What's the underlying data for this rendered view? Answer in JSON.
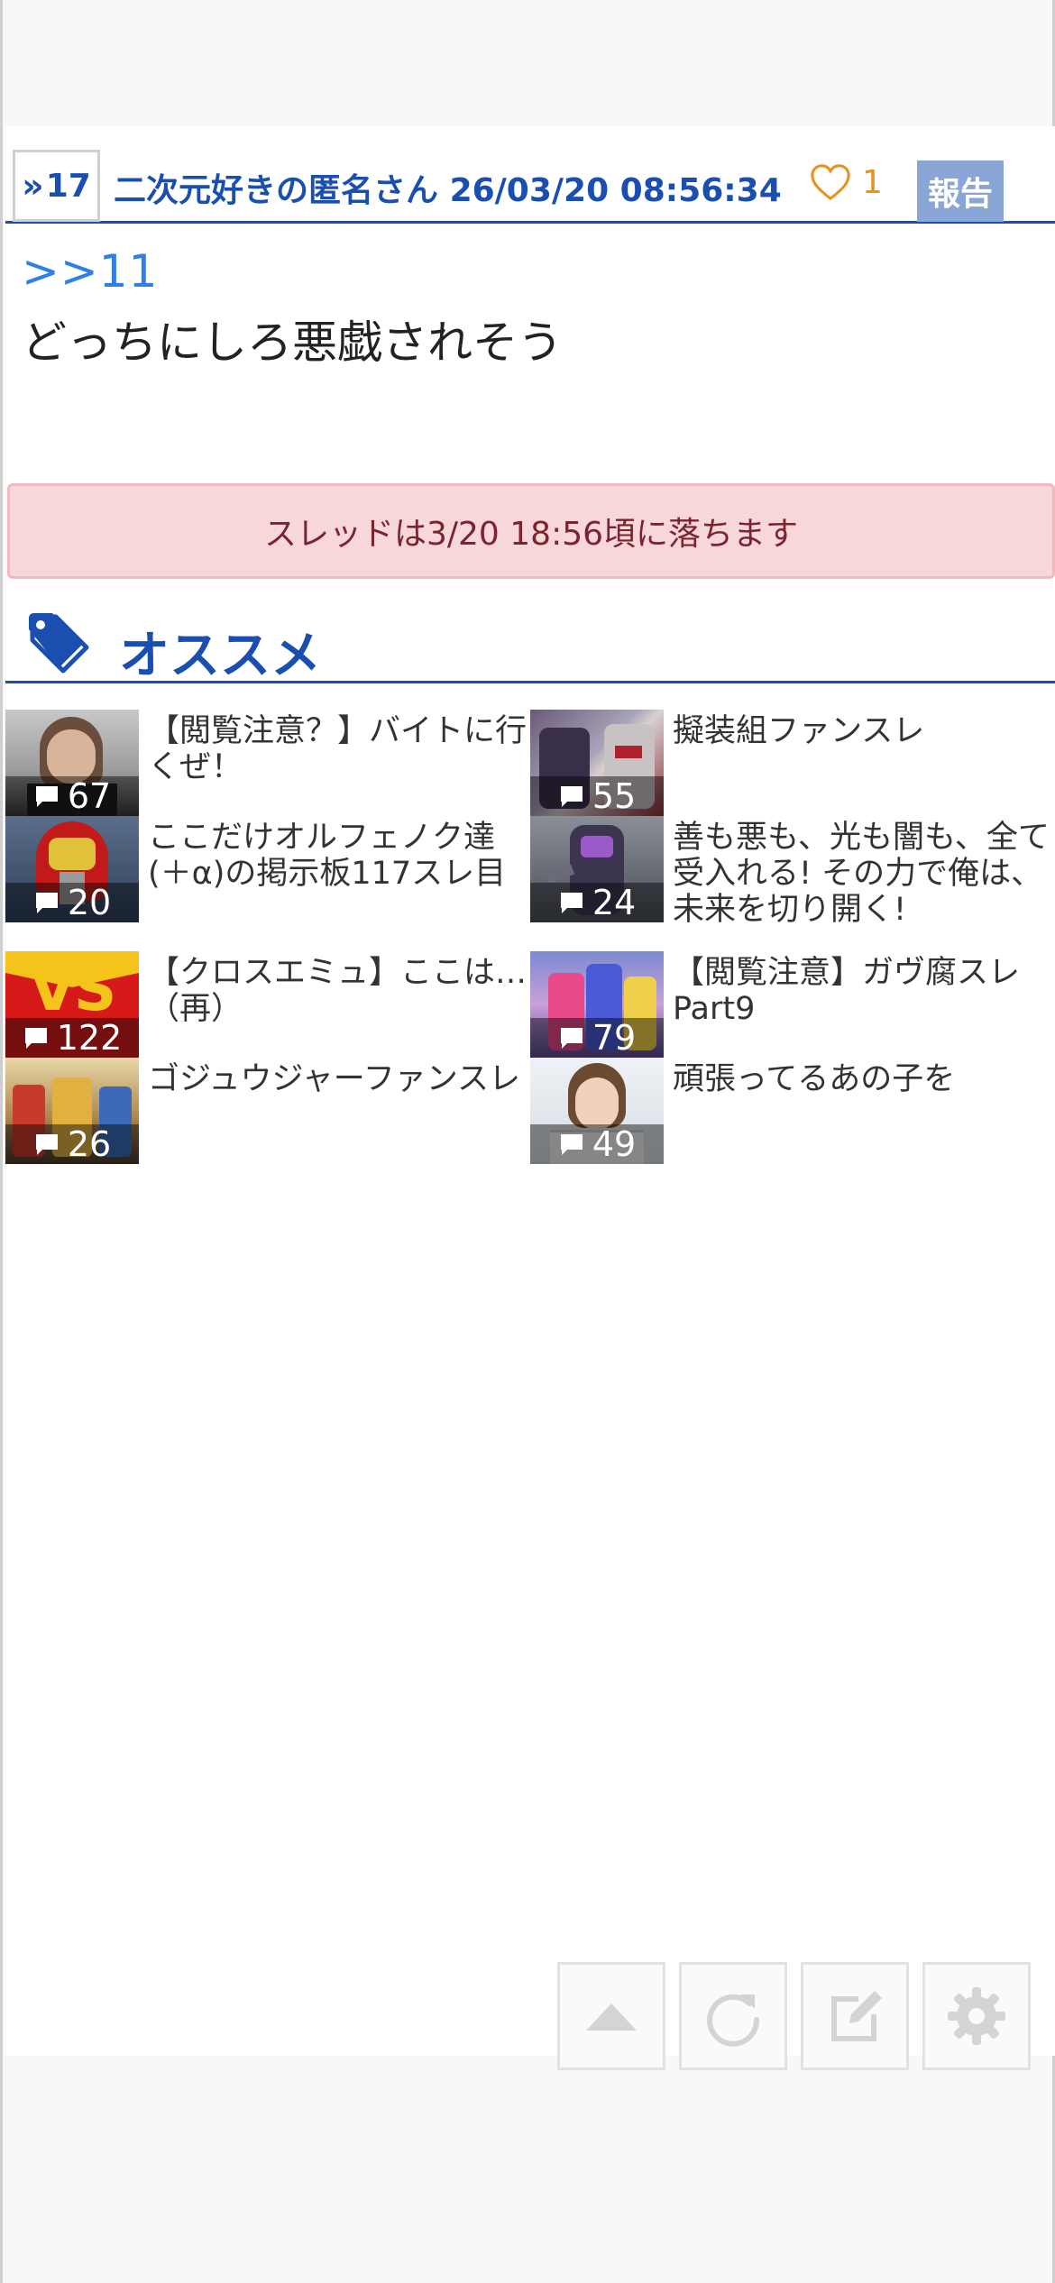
{
  "post": {
    "number_prefix": "»",
    "number": "17",
    "author": "二次元好きの匿名さん",
    "timestamp": "26/03/20 08:56:34",
    "likes": "1",
    "report_label": "報告",
    "anchor": ">>11",
    "text": "どっちにしろ悪戯されそう"
  },
  "notice": "スレッドは3/20 18:56頃に落ちます",
  "recommend": {
    "title": "オススメ",
    "items": [
      {
        "title": "【閲覧注意？】バイトに行くぜ！",
        "count": "67"
      },
      {
        "title": "擬装組ファンスレ",
        "count": "55"
      },
      {
        "title": "ここだけオルフェノク達(＋α)の掲示板117スレ目",
        "count": "20"
      },
      {
        "title": "善も悪も、光も闇も、全て受入れる! その力で俺は、未来を切り開く!",
        "count": "24"
      },
      {
        "title": "【クロスエミュ】ここは…（再）",
        "count": "122"
      },
      {
        "title": "【閲覧注意】ガヴ腐スレPart9",
        "count": "79"
      },
      {
        "title": "ゴジュウジャーファンスレ",
        "count": "26"
      },
      {
        "title": "頑張ってるあの子を",
        "count": "49"
      }
    ]
  },
  "colors": {
    "accent": "#1a4fb0",
    "anchor": "#2f7fe8",
    "like": "#e6921e",
    "report_bg": "#8aa6d6",
    "notice_bg": "#f8d7da",
    "notice_text": "#7a2430"
  },
  "icons": {
    "like": "heart-outline-icon",
    "recommend": "tag-icon",
    "comment": "speech-bubble-icon",
    "fabs": [
      "scroll-top-icon",
      "reload-icon",
      "edit-icon",
      "settings-icon"
    ]
  }
}
